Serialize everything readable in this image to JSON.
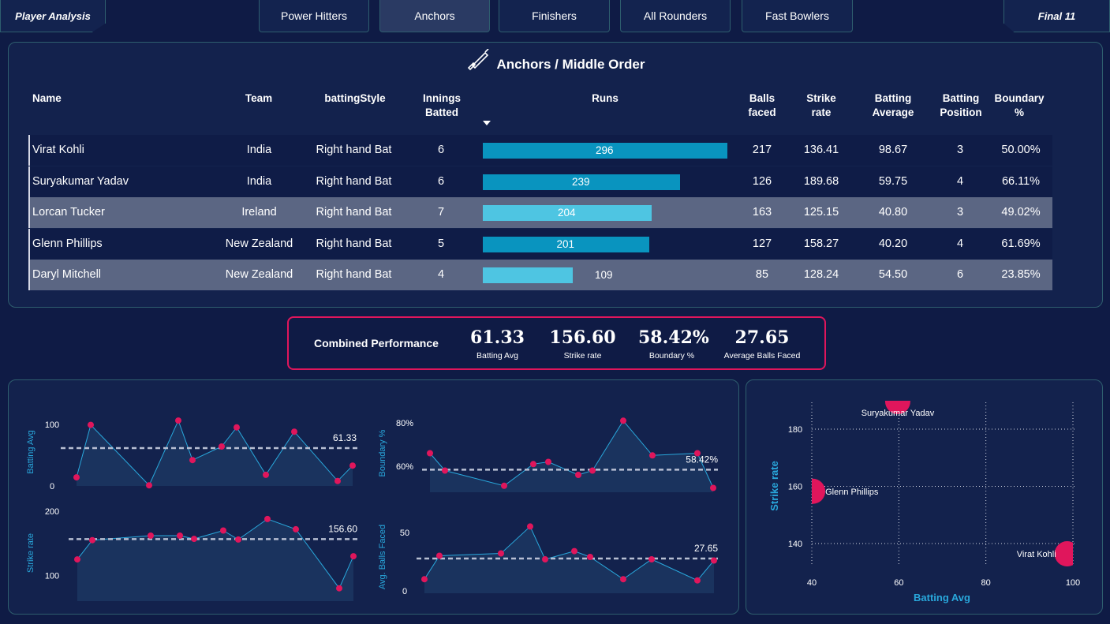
{
  "nav": {
    "left": "Player Analysis",
    "tabs": [
      "Power Hitters",
      "Anchors",
      "Finishers",
      "All Rounders",
      "Fast Bowlers"
    ],
    "active_tab": "Anchors",
    "right": "Final 11"
  },
  "table": {
    "title": "Anchors / Middle Order",
    "headers": {
      "name": "Name",
      "team": "Team",
      "style": "battingStyle",
      "innings": "Innings Batted",
      "runs": "Runs",
      "balls": "Balls faced",
      "sr": "Strike rate",
      "avg": "Batting Average",
      "pos": "Batting Position",
      "boundary": "Boundary %"
    },
    "rows": [
      {
        "name": "Virat Kohli",
        "team": "India",
        "style": "Right hand Bat",
        "innings": "6",
        "runs": "296",
        "balls": "217",
        "sr": "136.41",
        "avg": "98.67",
        "pos": "3",
        "boundary": "50.00%"
      },
      {
        "name": "Suryakumar Yadav",
        "team": "India",
        "style": "Right hand Bat",
        "innings": "6",
        "runs": "239",
        "balls": "126",
        "sr": "189.68",
        "avg": "59.75",
        "pos": "4",
        "boundary": "66.11%"
      },
      {
        "name": "Lorcan Tucker",
        "team": "Ireland",
        "style": "Right hand Bat",
        "innings": "7",
        "runs": "204",
        "balls": "163",
        "sr": "125.15",
        "avg": "40.80",
        "pos": "3",
        "boundary": "49.02%"
      },
      {
        "name": "Glenn Phillips",
        "team": "New Zealand",
        "style": "Right hand Bat",
        "innings": "5",
        "runs": "201",
        "balls": "127",
        "sr": "158.27",
        "avg": "40.20",
        "pos": "4",
        "boundary": "61.69%"
      },
      {
        "name": "Daryl Mitchell",
        "team": "New Zealand",
        "style": "Right hand Bat",
        "innings": "4",
        "runs": "109",
        "balls": "85",
        "sr": "128.24",
        "avg": "54.50",
        "pos": "6",
        "boundary": "23.85%"
      }
    ],
    "runs_max": 296
  },
  "combined": {
    "title": "Combined Performance",
    "kpis": [
      {
        "value": "61.33",
        "label": "Batting Avg"
      },
      {
        "value": "156.60",
        "label": "Strike rate"
      },
      {
        "value": "58.42%",
        "label": "Boundary %"
      },
      {
        "value": "27.65",
        "label": "Average Balls Faced"
      }
    ]
  },
  "colors": {
    "accent": "#e0165c",
    "line": "#29a8dc",
    "bar_dark": "#0994bf",
    "bar_light": "#4ec5e2",
    "area": "#1a335e",
    "bg": "#0f1b45"
  },
  "chart_data": [
    {
      "type": "line",
      "ylabel": "Batting Avg",
      "yticks": [
        0,
        100
      ],
      "ylim": [
        0,
        110
      ],
      "ref_value": 61.33,
      "ref_label": "61.33",
      "values": [
        14,
        99,
        1,
        106,
        42,
        64,
        95,
        18,
        88,
        8,
        33
      ]
    },
    {
      "type": "line",
      "ylabel": "Strike rate",
      "yticks": [
        100,
        200
      ],
      "ylim": [
        60,
        210
      ],
      "ref_value": 156.6,
      "ref_label": "156.60",
      "values": [
        125,
        155,
        162,
        162,
        157,
        170,
        156,
        188,
        172,
        80,
        130
      ]
    },
    {
      "type": "line",
      "ylabel": "Boundary %",
      "ytick_labels": [
        "60%",
        "80%"
      ],
      "yticks": [
        60,
        80
      ],
      "ylim": [
        48,
        84
      ],
      "ref_value": 58.42,
      "ref_label": "58.42%",
      "values": [
        66,
        58,
        51,
        61,
        62,
        56,
        58,
        81,
        65,
        66,
        50
      ]
    },
    {
      "type": "line",
      "ylabel": "Avg. Balls Faced",
      "yticks": [
        0,
        50
      ],
      "ylim": [
        -2,
        60
      ],
      "ref_value": 27.65,
      "ref_label": "27.65",
      "values": [
        10,
        30,
        32,
        55,
        27,
        34,
        29,
        10,
        27,
        9,
        26
      ]
    },
    {
      "type": "scatter",
      "xlabel": "Batting Avg",
      "ylabel": "Strike rate",
      "xticks": [
        40,
        60,
        80,
        100
      ],
      "yticks": [
        140,
        160,
        180
      ],
      "xlim": [
        40,
        100
      ],
      "ylim": [
        125,
        190
      ],
      "points": [
        {
          "label": "Suryakumar Yadav",
          "x": 59.75,
          "y": 189.68
        },
        {
          "label": "Glenn Phillips",
          "x": 40.2,
          "y": 158.27
        },
        {
          "label": "Virat Kohli",
          "x": 98.67,
          "y": 136.41
        }
      ]
    }
  ]
}
